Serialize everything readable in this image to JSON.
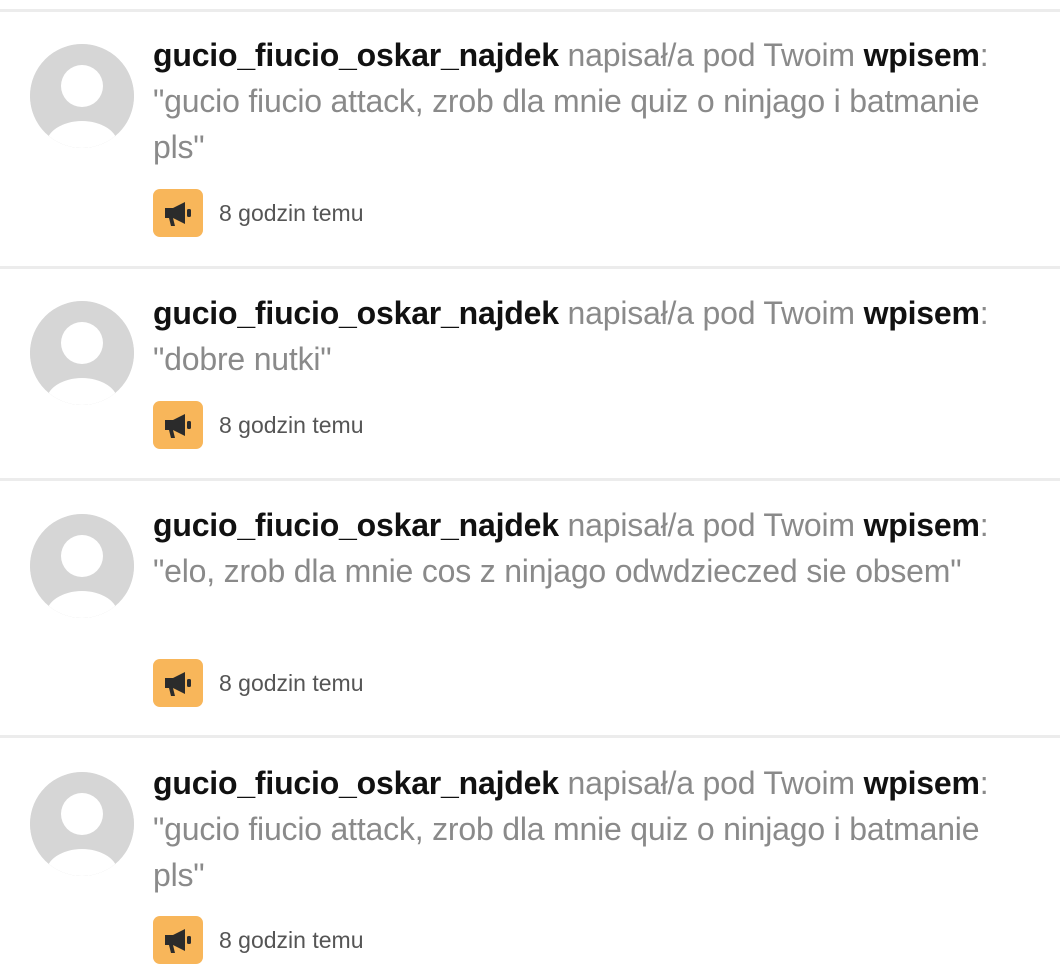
{
  "notifications": [
    {
      "username": "gucio_fiucio_oskar_najdek",
      "action": "napisał/a pod Twoim",
      "target": "wpisem",
      "separator": ":",
      "comment": "\"gucio fiucio attack, zrob dla mnie quiz o ninjago i batmanie pls\"",
      "time": "8 godzin temu",
      "icon": "megaphone-icon"
    },
    {
      "username": "gucio_fiucio_oskar_najdek",
      "action": "napisał/a pod Twoim",
      "target": "wpisem",
      "separator": ":",
      "comment": "\"dobre nutki\"",
      "time": "8 godzin temu",
      "icon": "megaphone-icon"
    },
    {
      "username": "gucio_fiucio_oskar_najdek",
      "action": "napisał/a pod Twoim",
      "target": "wpisem",
      "separator": ":",
      "comment": "\"elo, zrob dla mnie cos z ninjago odwdzieczed sie obsem\"",
      "time": "8 godzin temu",
      "icon": "megaphone-icon"
    },
    {
      "username": "gucio_fiucio_oskar_najdek",
      "action": "napisał/a pod Twoim",
      "target": "wpisem",
      "separator": ":",
      "comment": "\"gucio fiucio attack, zrob dla mnie quiz o ninjago i batmanie pls\"",
      "time": "8 godzin temu",
      "icon": "megaphone-icon"
    }
  ],
  "colors": {
    "badge": "#f8b65a",
    "icon": "#2b2b2b",
    "avatar_bg": "#d6d6d6",
    "username": "#111111",
    "body_text": "#8a8a8a",
    "divider": "#ececec"
  }
}
